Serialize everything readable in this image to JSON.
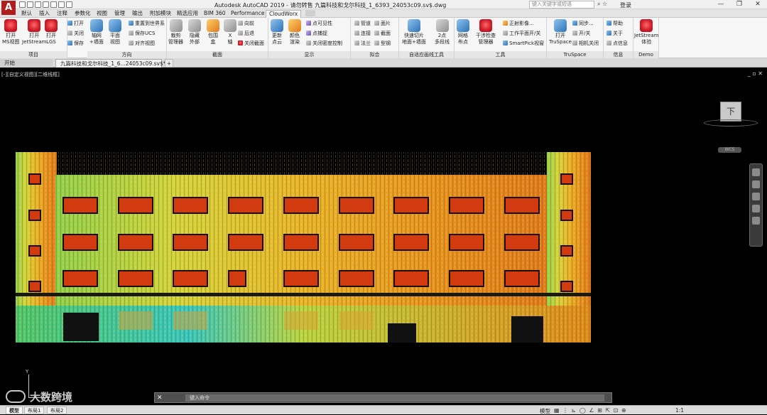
{
  "app": {
    "logo_letter": "A",
    "window_title": "Autodesk AutoCAD 2019 - 请勿转售    九篇科技和戈尔科技_1_6393_24053c09.sv$.dwg",
    "search_placeholder": "键入关键字或短语",
    "login_label": "登录",
    "controls": [
      "—",
      "❐",
      "✕"
    ]
  },
  "ribbon_tabs": [
    "默认",
    "插入",
    "注释",
    "参数化",
    "视图",
    "管理",
    "输出",
    "附加模块",
    "精选应用",
    "BIM 360",
    "Performance",
    "CloudWorx"
  ],
  "active_tab": "CloudWorx",
  "panels": {
    "project": {
      "title": "项目",
      "buttons": [
        "打开\nMS视图",
        "打开\nJetStream",
        "打开\nLGS"
      ],
      "small": [
        "打开",
        "关闭",
        "保存"
      ]
    },
    "direction": {
      "title": "方向",
      "buttons": [
        "轴网\n+墙面",
        "平面\n视图"
      ],
      "small": [
        "重置到世界系",
        "保存UCS",
        "对齐视图"
      ]
    },
    "clip": {
      "title": "截面",
      "buttons": [
        "裁剪\n管理器",
        "隐藏\n外部",
        "包围\n盒",
        "X\n轴"
      ],
      "small": [
        "向前",
        "后退",
        "关闭截面"
      ]
    },
    "display": {
      "title": "显示",
      "buttons": [
        "更新\n点云",
        "颜色\n渲染"
      ],
      "small": [
        "点可见性",
        "点捕捉",
        "关闭密度控制"
      ]
    },
    "fit": {
      "title": "拟合",
      "small": [
        "管道",
        "连接",
        "法兰",
        "面片",
        "截面",
        "型钢"
      ]
    },
    "auto": {
      "title": "自适应画线工具",
      "buttons": [
        "快速切片\n地面+墙面",
        "2点\n多段线"
      ]
    },
    "tools": {
      "title": "工具",
      "buttons": [
        "网格\n布点",
        "干涉检查\n管理器"
      ],
      "small": [
        "正射影像...",
        "工作平面开/关",
        "SmartPick视窗"
      ]
    },
    "truspace": {
      "title": "TruSpace",
      "buttons": [
        "打开\nTruSpace"
      ],
      "small": [
        "同步...",
        "开/关",
        "相机关闭"
      ]
    },
    "info": {
      "title": "信息",
      "small": [
        "帮助",
        "关于",
        "点信息"
      ]
    },
    "demo": {
      "title": "Demo",
      "buttons": [
        "JetStream\n体验"
      ]
    }
  },
  "doc_tabs": {
    "home": "开始",
    "file": "九篇科技和戈尔科技_1_6...24053c09.sv$*",
    "add": "+"
  },
  "viewport": {
    "label": "[-][自定义视图][二维线框]",
    "viewcube_face": "下",
    "wcs_label": "WCS",
    "ucs_y": "Y",
    "ucs_x": "X"
  },
  "command_line": {
    "close": "✕",
    "placeholder": "键入命令"
  },
  "statusbar": {
    "layout_tabs": [
      "模型",
      "布局1",
      "布局2"
    ],
    "model_label": "模型",
    "scale": "1:1"
  },
  "watermark": "大数跨境",
  "colors": {
    "brand_red": "#b01e1e",
    "canvas_bg": "#000000",
    "ribbon_bg": "#f6f6f6"
  }
}
